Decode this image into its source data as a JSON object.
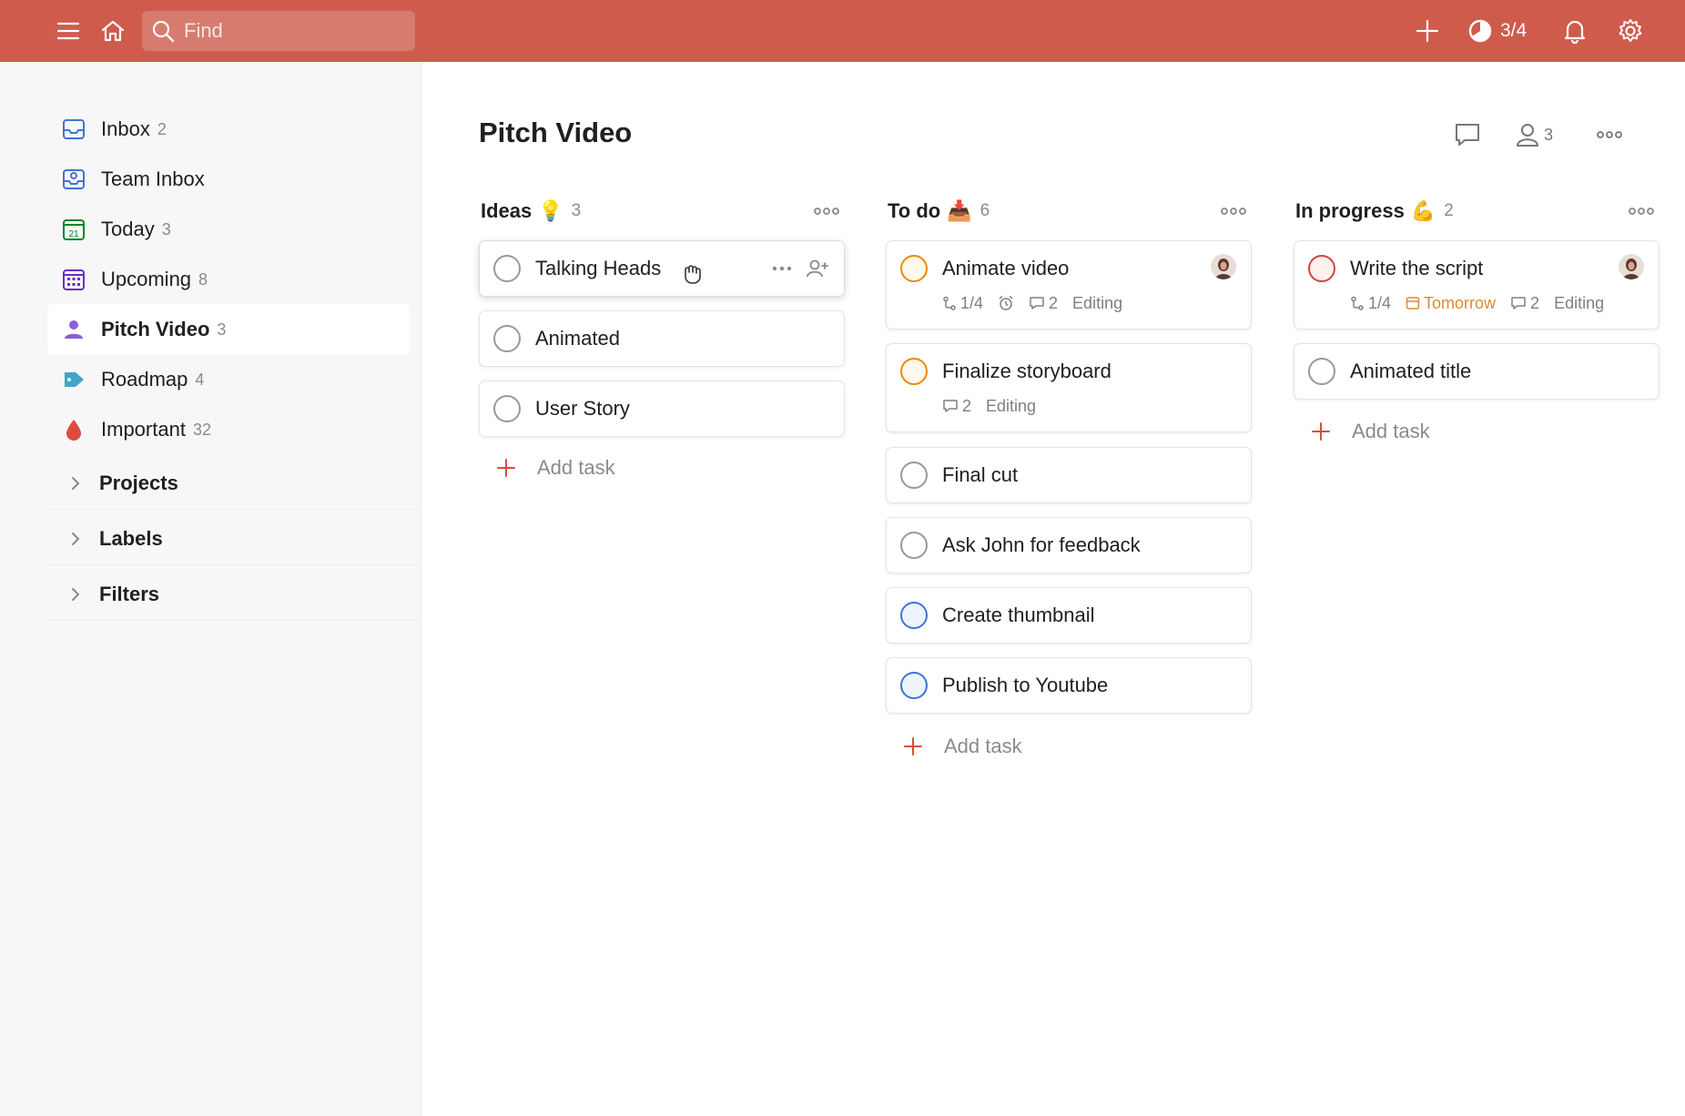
{
  "colors": {
    "topbar": "#cf5b4c",
    "active_project": "#8a5dde",
    "orange_priority": "#eb8909",
    "red_priority": "#d1453b",
    "blue_priority": "#4073d6",
    "add_plus": "#dc4c3e"
  },
  "topbar": {
    "search_placeholder": "Find",
    "karma_label": "3/4",
    "icons": [
      "menu-icon",
      "home-icon",
      "search-icon",
      "plus-icon",
      "karma-icon",
      "bell-icon",
      "gear-icon"
    ]
  },
  "sidebar": {
    "items": [
      {
        "label": "Inbox",
        "count": "2",
        "icon": "inbox-icon"
      },
      {
        "label": "Team Inbox",
        "count": "",
        "icon": "team-inbox-icon"
      },
      {
        "label": "Today",
        "count": "3",
        "icon": "calendar-today-icon"
      },
      {
        "label": "Upcoming",
        "count": "8",
        "icon": "calendar-upcoming-icon"
      },
      {
        "label": "Pitch Video",
        "count": "3",
        "icon": "person-icon",
        "active": true
      },
      {
        "label": "Roadmap",
        "count": "4",
        "icon": "tag-icon"
      },
      {
        "label": "Important",
        "count": "32",
        "icon": "drop-icon"
      }
    ],
    "sections": [
      {
        "label": "Projects"
      },
      {
        "label": "Labels"
      },
      {
        "label": "Filters"
      }
    ]
  },
  "main": {
    "title": "Pitch Video",
    "shared_count": "3",
    "columns": [
      {
        "title": "Ideas",
        "emoji": "💡",
        "count": "3",
        "tasks": [
          {
            "title": "Talking Heads"
          },
          {
            "title": "Animated"
          },
          {
            "title": "User Story"
          }
        ],
        "add_label": "Add task"
      },
      {
        "title": "To do",
        "emoji": "📥",
        "count": "6",
        "tasks": [
          {
            "title": "Animate video",
            "priority": "orange",
            "subtasks": "1/4",
            "comments": "2",
            "label": "Editing"
          },
          {
            "title": "Finalize storyboard",
            "priority": "orange",
            "comments": "2",
            "label": "Editing"
          },
          {
            "title": "Final cut"
          },
          {
            "title": "Ask John for feedback"
          },
          {
            "title": "Create thumbnail",
            "priority": "blue"
          },
          {
            "title": "Publish to Youtube",
            "priority": "blue"
          }
        ],
        "add_label": "Add task"
      },
      {
        "title": "In progress",
        "emoji": "💪",
        "count": "2",
        "tasks": [
          {
            "title": "Write the script",
            "priority": "red",
            "subtasks": "1/4",
            "due": "Tomorrow",
            "comments": "2",
            "label": "Editing"
          },
          {
            "title": "Animated title"
          }
        ],
        "add_label": "Add task"
      }
    ]
  }
}
